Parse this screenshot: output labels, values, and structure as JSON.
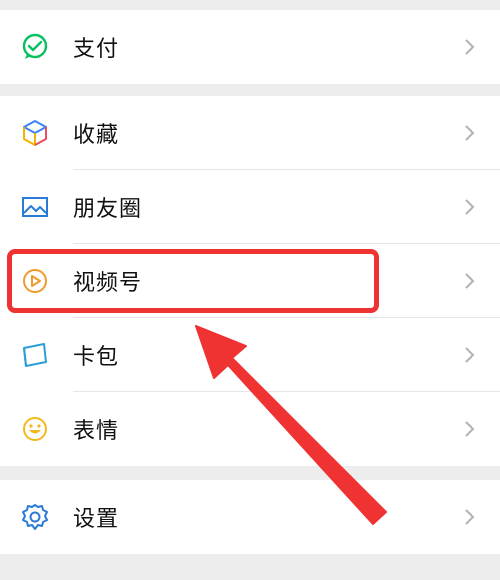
{
  "menu": {
    "payment": {
      "label": "支付",
      "icon": "wechat-pay-icon",
      "color": "#07c160"
    },
    "favorites": {
      "label": "收藏",
      "icon": "cube-icon"
    },
    "moments": {
      "label": "朋友圈",
      "icon": "image-icon",
      "color": "#2a7bd8"
    },
    "channels": {
      "label": "视频号",
      "icon": "play-circle-icon",
      "color": "#f09a2e"
    },
    "cards": {
      "label": "卡包",
      "icon": "card-wallet-icon",
      "color": "#2a9fd8"
    },
    "stickers": {
      "label": "表情",
      "icon": "smiley-icon",
      "color": "#f3b81a"
    },
    "settings": {
      "label": "设置",
      "icon": "gear-icon",
      "color": "#2a7bd8"
    }
  },
  "annotation": {
    "highlight_color": "#ef3232",
    "target": "视频号"
  }
}
